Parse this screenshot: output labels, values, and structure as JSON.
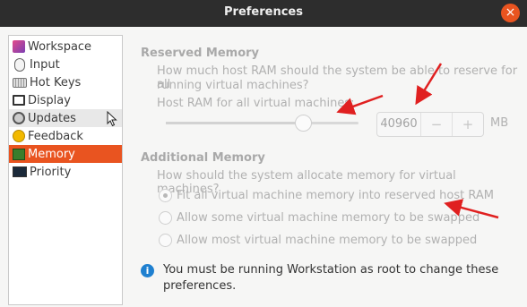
{
  "window": {
    "title": "Preferences",
    "close_glyph": "×"
  },
  "sidebar": {
    "items": [
      {
        "label": "Workspace",
        "icon": "workspace-icon"
      },
      {
        "label": "Input",
        "icon": "mouse-icon"
      },
      {
        "label": "Hot Keys",
        "icon": "keyboard-icon"
      },
      {
        "label": "Display",
        "icon": "monitor-icon"
      },
      {
        "label": "Updates",
        "icon": "updates-icon"
      },
      {
        "label": "Feedback",
        "icon": "smiley-icon"
      },
      {
        "label": "Memory",
        "icon": "memory-chip-icon",
        "selected": true
      },
      {
        "label": "Priority",
        "icon": "priority-icon"
      }
    ]
  },
  "reserved": {
    "title": "Reserved Memory",
    "question_line1": "How much host RAM should the system be able to reserve for all",
    "question_line2": "running virtual machines?",
    "slider_label": "Host RAM for all virtual machines:",
    "slider_fraction": 0.71,
    "value": "40960",
    "minus": "−",
    "plus": "+",
    "unit": "MB"
  },
  "additional": {
    "title": "Additional Memory",
    "question": "How should the system allocate memory for virtual machines?",
    "options": [
      {
        "label": "Fit all virtual machine memory into reserved host RAM",
        "checked": true
      },
      {
        "label": "Allow some virtual machine memory to be swapped",
        "checked": false
      },
      {
        "label": "Allow most virtual machine memory to be swapped",
        "checked": false
      }
    ]
  },
  "info": {
    "icon": "info-icon",
    "glyph": "i",
    "line1": "You must be running Workstation as root to change these",
    "line2": "preferences."
  },
  "colors": {
    "accent": "#e95420",
    "titlebar": "#2d2d2d",
    "info": "#1f80d0",
    "annotation": "#e02020"
  }
}
